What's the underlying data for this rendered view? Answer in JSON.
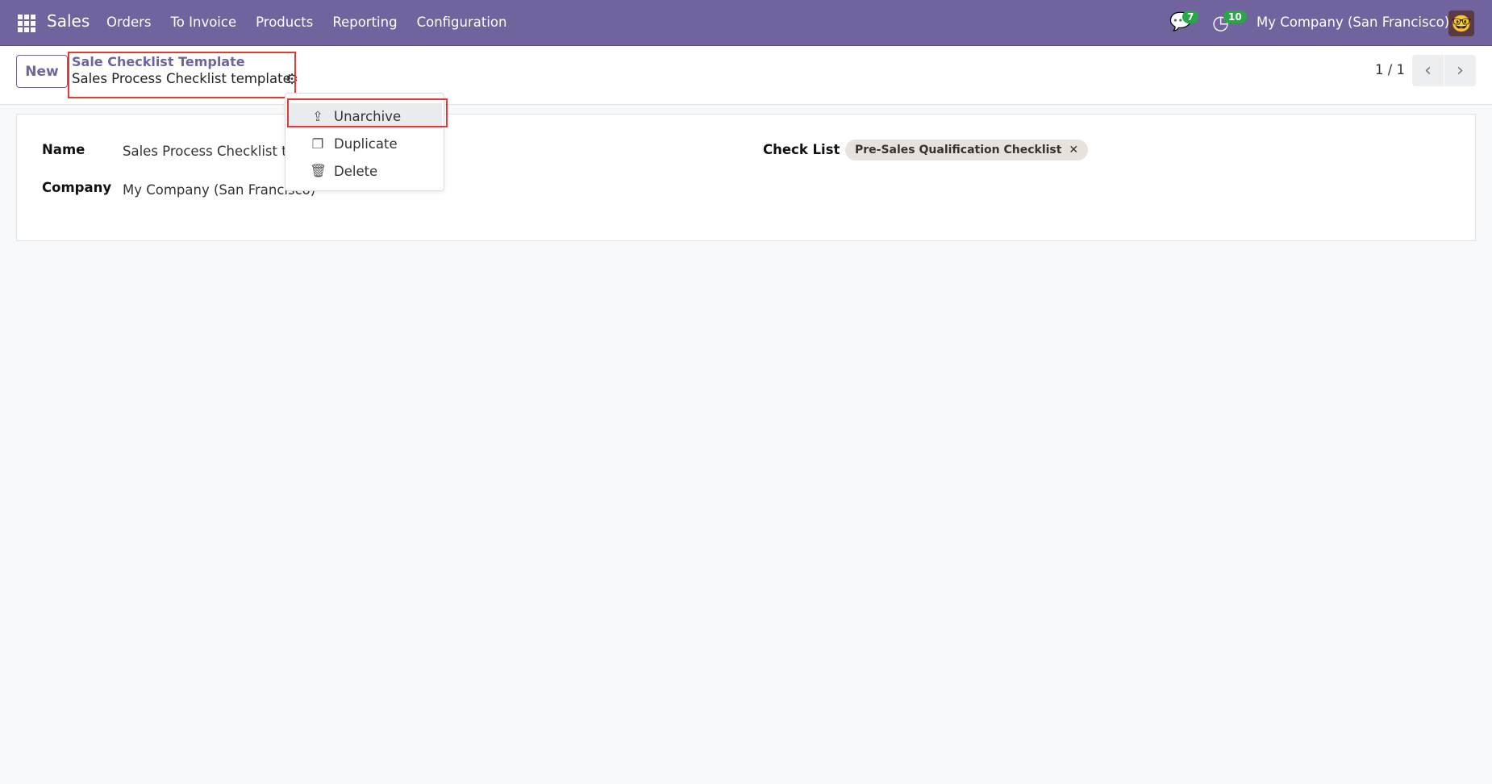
{
  "navbar": {
    "app_name": "Sales",
    "menu": [
      "Orders",
      "To Invoice",
      "Products",
      "Reporting",
      "Configuration"
    ],
    "messages_count": "7",
    "activities_count": "10",
    "company": "My Company (San Francisco)"
  },
  "control": {
    "new_label": "New",
    "breadcrumb_parent": "Sale Checklist Template",
    "breadcrumb_current": "Sales Process Checklist template",
    "pager": "1 / 1"
  },
  "actions_menu": {
    "items": [
      "Unarchive",
      "Duplicate",
      "Delete"
    ]
  },
  "form": {
    "name_label": "Name",
    "name_value": "Sales Process Checklist template",
    "company_label": "Company",
    "company_value": "My Company (San Francisco)",
    "checklist_label": "Check List",
    "checklist_tags": [
      "Pre-Sales Qualification Checklist"
    ]
  },
  "colors": {
    "brand": "#71639e",
    "badge": "#28a745",
    "highlight": "#e53935"
  }
}
